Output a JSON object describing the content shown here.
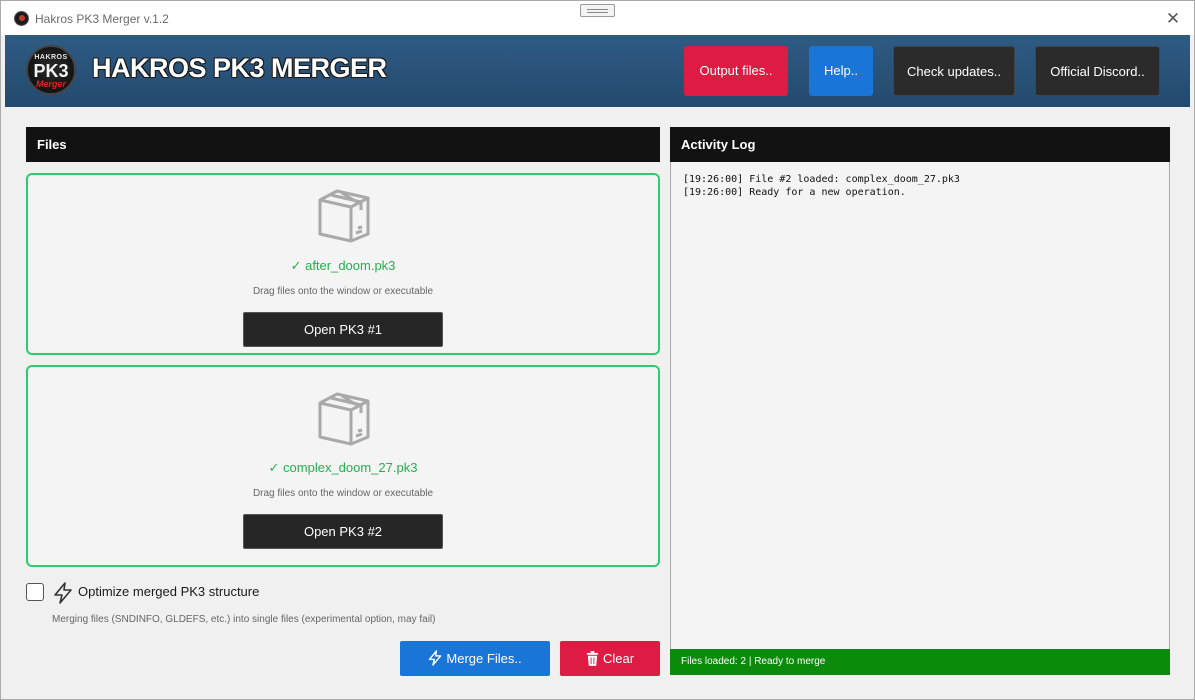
{
  "window": {
    "title": "Hakros PK3 Merger v.1.2",
    "close_glyph": "✕"
  },
  "header": {
    "logo": {
      "top": "HAKROS",
      "mid": "PK3",
      "bottom": "Merger"
    },
    "brand": "HAKROS PK3 MERGER",
    "buttons": {
      "output": "Output files..",
      "help": "Help..",
      "updates": "Check updates..",
      "discord": "Official Discord.."
    }
  },
  "files": {
    "heading": "Files",
    "slots": [
      {
        "filename": "✓ after_doom.pk3",
        "hint": "Drag files onto the window or executable",
        "button": "Open PK3 #1"
      },
      {
        "filename": "✓ complex_doom_27.pk3",
        "hint": "Drag files onto the window or executable",
        "button": "Open PK3 #2"
      }
    ]
  },
  "options": {
    "optimize_label": "Optimize merged PK3 structure",
    "optimize_checked": false,
    "optimize_desc": "Merging files (SNDINFO, GLDEFS, etc.) into single files (experimental option, may fail)"
  },
  "actions": {
    "merge": "Merge Files..",
    "clear": "Clear"
  },
  "log": {
    "heading": "Activity Log",
    "lines": [
      "[19:26:00] File #2 loaded: complex_doom_27.pk3",
      "[19:26:00] Ready for a new operation."
    ],
    "status": "Files loaded: 2 | Ready to merge"
  },
  "colors": {
    "header_bg": "#2a5278",
    "accent_red": "#dc1c42",
    "accent_blue": "#1a75d9",
    "success_green": "#22b14c",
    "status_green": "#0b8a0b"
  }
}
